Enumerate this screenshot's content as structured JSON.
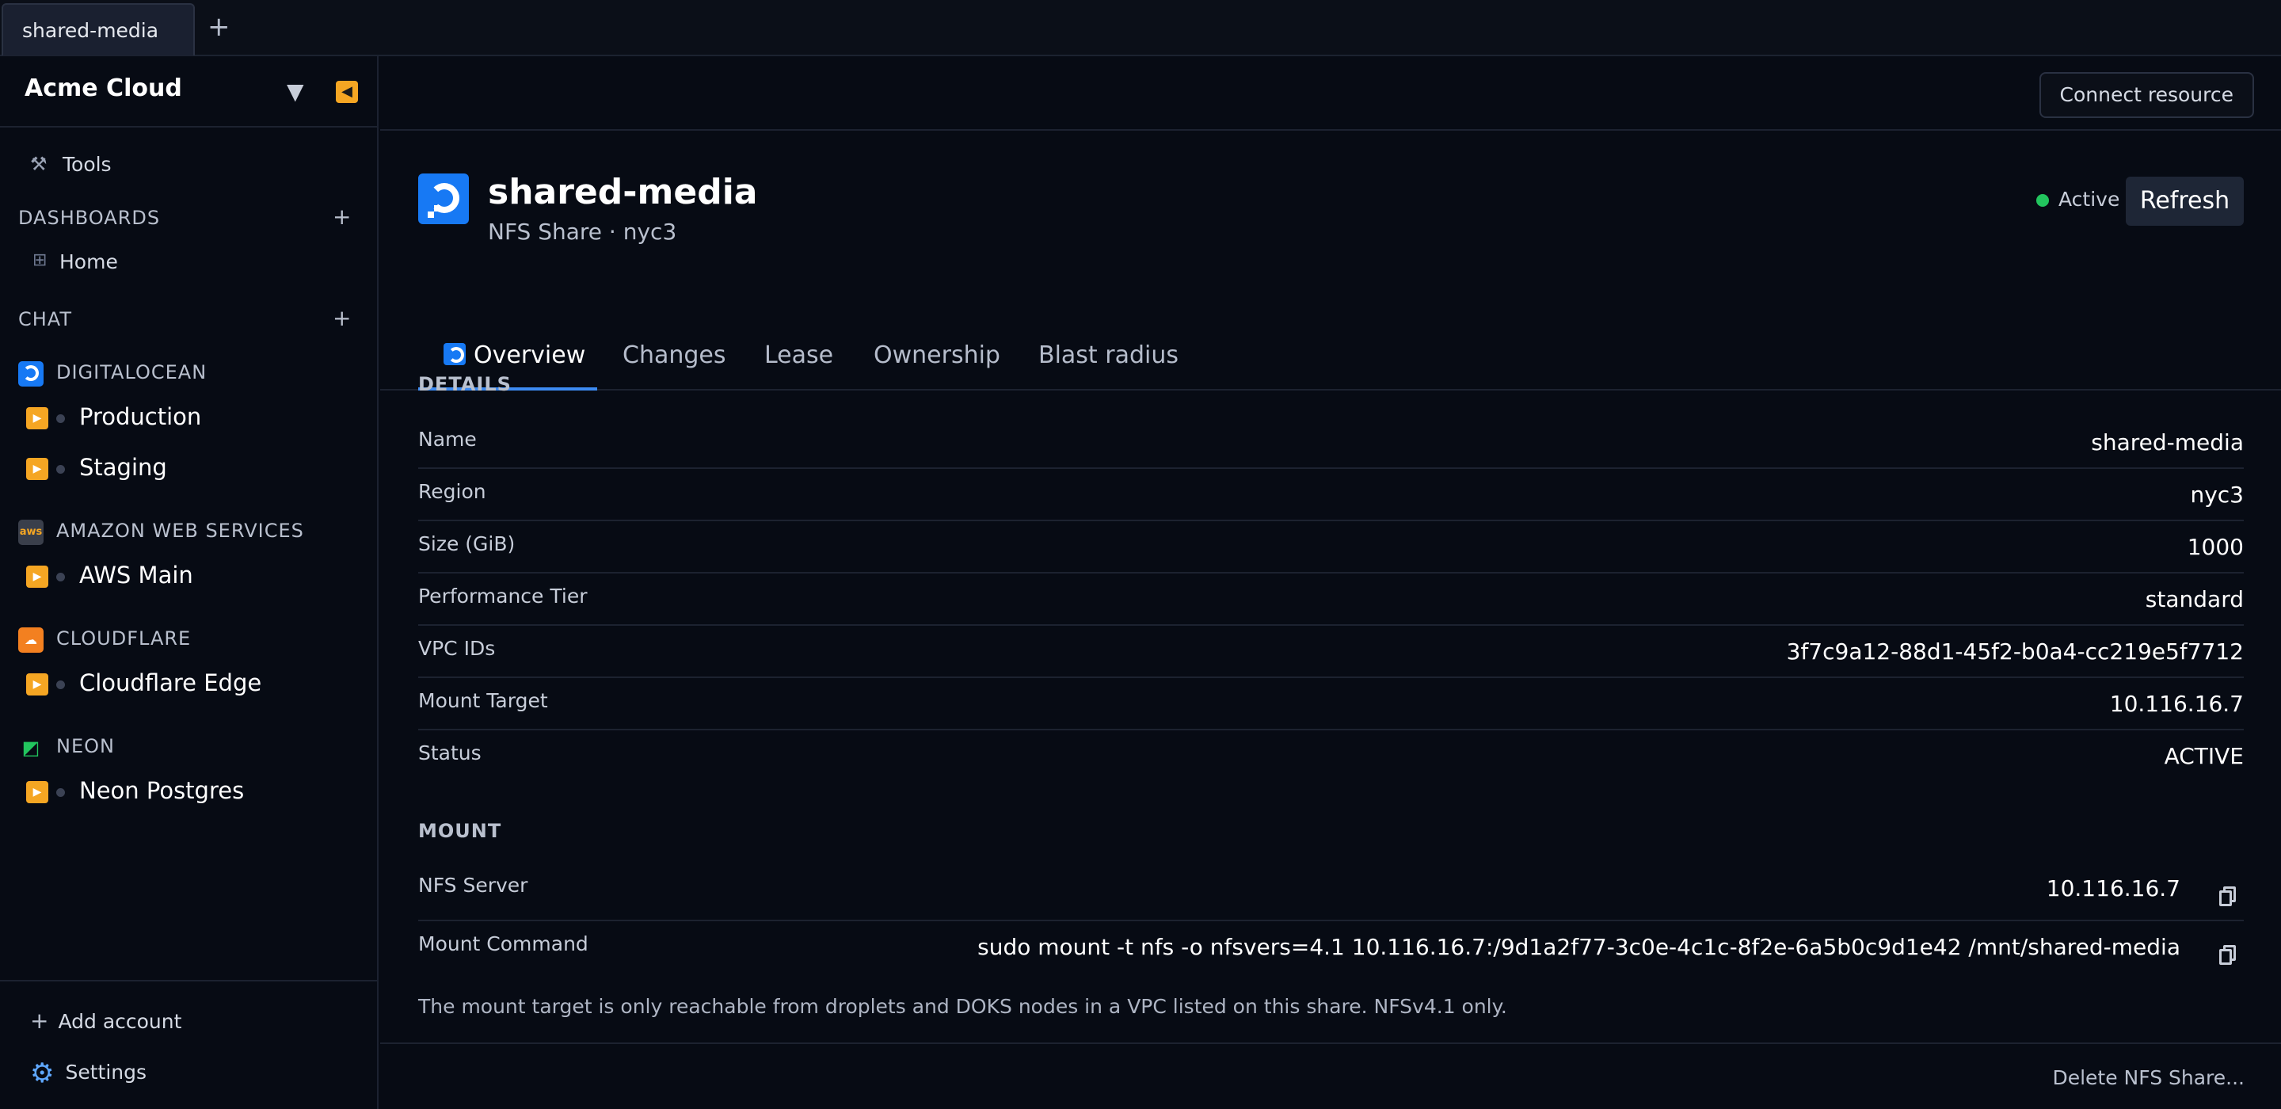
{
  "tabstrip": {
    "tab_label": "shared-media",
    "add_label": "+"
  },
  "sidebar": {
    "org_name": "Acme Cloud",
    "tools_label": "Tools",
    "dashboards_header": "DASHBOARDS",
    "dashboards_items": [
      {
        "label": "Home"
      }
    ],
    "chat_header": "CHAT",
    "providers": [
      {
        "name": "DIGITALOCEAN",
        "logo": "digitalocean-logo",
        "color": "#1779f4",
        "items": [
          {
            "label": "Production"
          },
          {
            "label": "Staging"
          }
        ]
      },
      {
        "name": "AMAZON WEB SERVICES",
        "logo": "aws-logo",
        "color": "#3a3f4b",
        "logo_text": "aws",
        "items": [
          {
            "label": "AWS Main"
          }
        ]
      },
      {
        "name": "CLOUDFLARE",
        "logo": "cloudflare-logo",
        "color": "#f38020",
        "items": [
          {
            "label": "Cloudflare Edge"
          }
        ]
      },
      {
        "name": "NEON",
        "logo": "neon-logo",
        "color": "#22c55e",
        "items": [
          {
            "label": "Neon Postgres"
          }
        ]
      }
    ],
    "add_account_label": "Add account",
    "settings_label": "Settings"
  },
  "topbar": {
    "connect_label": "Connect resource"
  },
  "resource": {
    "title": "shared-media",
    "subtitle": "NFS Share · nyc3",
    "status": "Active",
    "status_color": "#22c55e",
    "refresh_label": "Refresh"
  },
  "tabs": [
    {
      "label": "Overview",
      "active": true
    },
    {
      "label": "Changes"
    },
    {
      "label": "Lease"
    },
    {
      "label": "Ownership"
    },
    {
      "label": "Blast radius"
    }
  ],
  "details": {
    "header": "DETAILS",
    "rows": [
      {
        "key": "Name",
        "value": "shared-media"
      },
      {
        "key": "Region",
        "value": "nyc3"
      },
      {
        "key": "Size (GiB)",
        "value": "1000"
      },
      {
        "key": "Performance Tier",
        "value": "standard"
      },
      {
        "key": "VPC IDs",
        "value": "3f7c9a12-88d1-45f2-b0a4-cc219e5f7712"
      },
      {
        "key": "Mount Target",
        "value": "10.116.16.7"
      },
      {
        "key": "Status",
        "value": "ACTIVE"
      }
    ]
  },
  "mount": {
    "header": "MOUNT",
    "rows": [
      {
        "key": "NFS Server",
        "value": "10.116.16.7"
      },
      {
        "key": "Mount Command",
        "value": "sudo mount -t nfs -o nfsvers=4.1 10.116.16.7:/9d1a2f77-3c0e-4c1c-8f2e-6a5b0c9d1e42 /mnt/shared-media"
      }
    ],
    "note": "The mount target is only reachable from droplets and DOKS nodes in a VPC listed on this share. NFSv4.1 only."
  },
  "footer": {
    "delete_label": "Delete NFS Share..."
  },
  "colors": {
    "accent": "#3d8bf2",
    "play": "#f5a623",
    "background": "#070b14"
  }
}
